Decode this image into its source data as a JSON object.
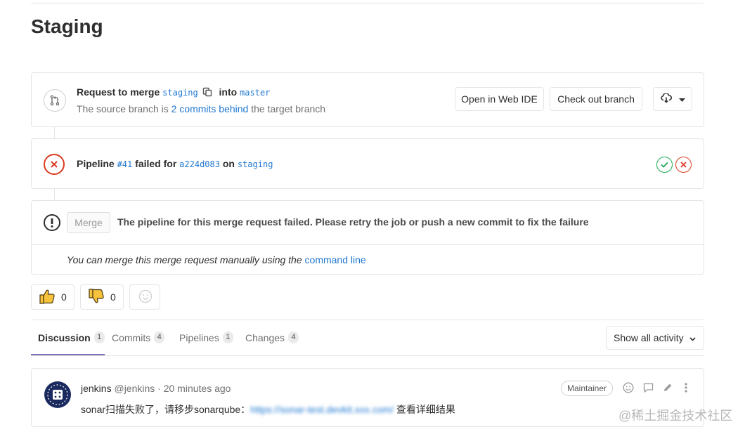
{
  "page": {
    "title": "Staging"
  },
  "merge_request": {
    "request_prefix": "Request to merge",
    "source_branch": "staging",
    "into_label": "into",
    "target_branch": "master",
    "status_prefix": "The source branch is",
    "behind_link": "2 commits behind",
    "status_suffix": "the target branch",
    "open_web_ide_label": "Open in Web IDE",
    "checkout_label": "Check out branch",
    "download_icon": "cloud-download-icon"
  },
  "pipeline": {
    "prefix": "Pipeline",
    "id": "#41",
    "status_text": "failed for",
    "commit": "a224d083",
    "on_label": "on",
    "branch": "staging",
    "stage_icons": [
      "stage-success-icon",
      "stage-failed-icon"
    ]
  },
  "merge_box": {
    "merge_button_label": "Merge",
    "failure_message": "The pipeline for this merge request failed. Please retry the job or push a new commit to fix the failure",
    "manual_prefix": "You can merge this merge request manually using the",
    "manual_link": "command line"
  },
  "awards": {
    "thumbs_up_count": "0",
    "thumbs_down_count": "0"
  },
  "tabs": [
    {
      "label": "Discussion",
      "count": "1",
      "active": true
    },
    {
      "label": "Commits",
      "count": "4",
      "active": false
    },
    {
      "label": "Pipelines",
      "count": "1",
      "active": false
    },
    {
      "label": "Changes",
      "count": "4",
      "active": false
    }
  ],
  "activity_filter": {
    "label": "Show all activity"
  },
  "note": {
    "author_name": "jenkins",
    "author_handle": "@jenkins",
    "time": "· 20 minutes ago",
    "role": "Maintainer",
    "body_prefix": "sonar扫描失败了，请移步sonarqube：",
    "body_link": "https://sonar-test.devkit.xxx.com/",
    "body_suffix": " 查看详细结果"
  },
  "watermark": "@稀土掘金技术社区",
  "colors": {
    "link": "#1f78d1",
    "failed": "#db3b21",
    "success": "#1aaa55",
    "tab_active": "#7b6fba"
  }
}
